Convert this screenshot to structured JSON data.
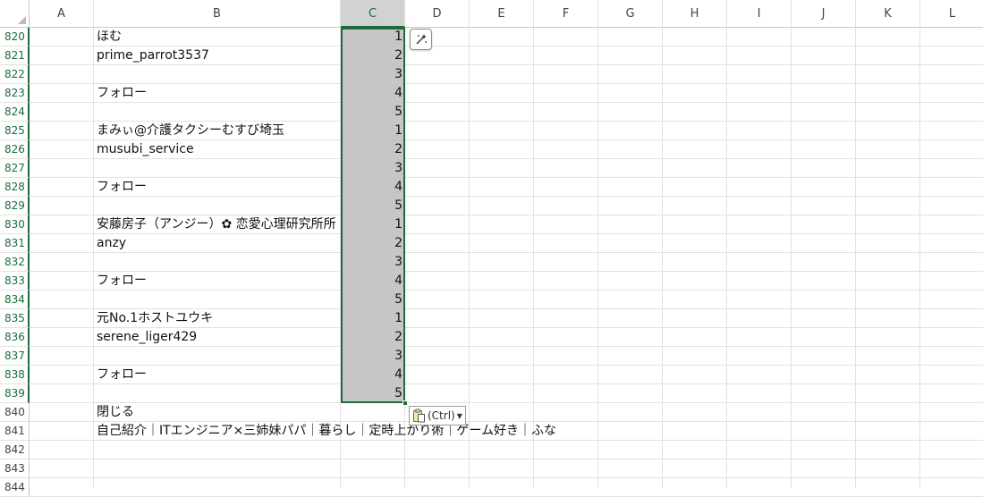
{
  "columns": [
    "A",
    "B",
    "C",
    "D",
    "E",
    "F",
    "G",
    "H",
    "I",
    "J",
    "K",
    "L"
  ],
  "selected_column": "C",
  "rows": [
    {
      "num": "820",
      "b": "ほむ",
      "c": "1",
      "sel": true
    },
    {
      "num": "821",
      "b": "prime_parrot3537",
      "c": "2",
      "sel": true
    },
    {
      "num": "822",
      "b": "",
      "c": "3",
      "sel": true
    },
    {
      "num": "823",
      "b": "フォロー",
      "c": "4",
      "sel": true
    },
    {
      "num": "824",
      "b": "",
      "c": "5",
      "sel": true
    },
    {
      "num": "825",
      "b": "まみぃ@介護タクシーむすび埼玉",
      "c": "1",
      "sel": true
    },
    {
      "num": "826",
      "b": "musubi_service",
      "c": "2",
      "sel": true
    },
    {
      "num": "827",
      "b": "",
      "c": "3",
      "sel": true
    },
    {
      "num": "828",
      "b": "フォロー",
      "c": "4",
      "sel": true
    },
    {
      "num": "829",
      "b": "",
      "c": "5",
      "sel": true
    },
    {
      "num": "830",
      "b": "安藤房子（アンジー）✿ 恋愛心理研究所所",
      "c": "1",
      "sel": true
    },
    {
      "num": "831",
      "b": "anzy",
      "c": "2",
      "sel": true
    },
    {
      "num": "832",
      "b": "",
      "c": "3",
      "sel": true
    },
    {
      "num": "833",
      "b": "フォロー",
      "c": "4",
      "sel": true
    },
    {
      "num": "834",
      "b": "",
      "c": "5",
      "sel": true
    },
    {
      "num": "835",
      "b": "元No.1ホストユウキ",
      "c": "1",
      "sel": true
    },
    {
      "num": "836",
      "b": "serene_liger429",
      "c": "2",
      "sel": true
    },
    {
      "num": "837",
      "b": "",
      "c": "3",
      "sel": true
    },
    {
      "num": "838",
      "b": "フォロー",
      "c": "4",
      "sel": true
    },
    {
      "num": "839",
      "b": "",
      "c": "5",
      "sel": true
    },
    {
      "num": "840",
      "b": "閉じる",
      "c": "",
      "sel": false
    },
    {
      "num": "841",
      "b": "自己紹介｜ITエンジニア×三姉妹パパ｜暮らし｜定時上がり術｜ゲーム好き｜ふな",
      "c": "",
      "sel": false
    },
    {
      "num": "842",
      "b": "",
      "c": "",
      "sel": false
    },
    {
      "num": "843",
      "b": "",
      "c": "",
      "sel": false
    },
    {
      "num": "844",
      "b": "",
      "c": "",
      "sel": false
    }
  ],
  "paste_options": {
    "label": "(Ctrl)",
    "icon": "clipboard-icon"
  },
  "quick_analysis": {
    "icon": "quick-analysis-icon"
  },
  "colors": {
    "accent": "#1e6b3a",
    "selection_fill": "#c6c6c6",
    "gridline": "#e1e1e1"
  }
}
